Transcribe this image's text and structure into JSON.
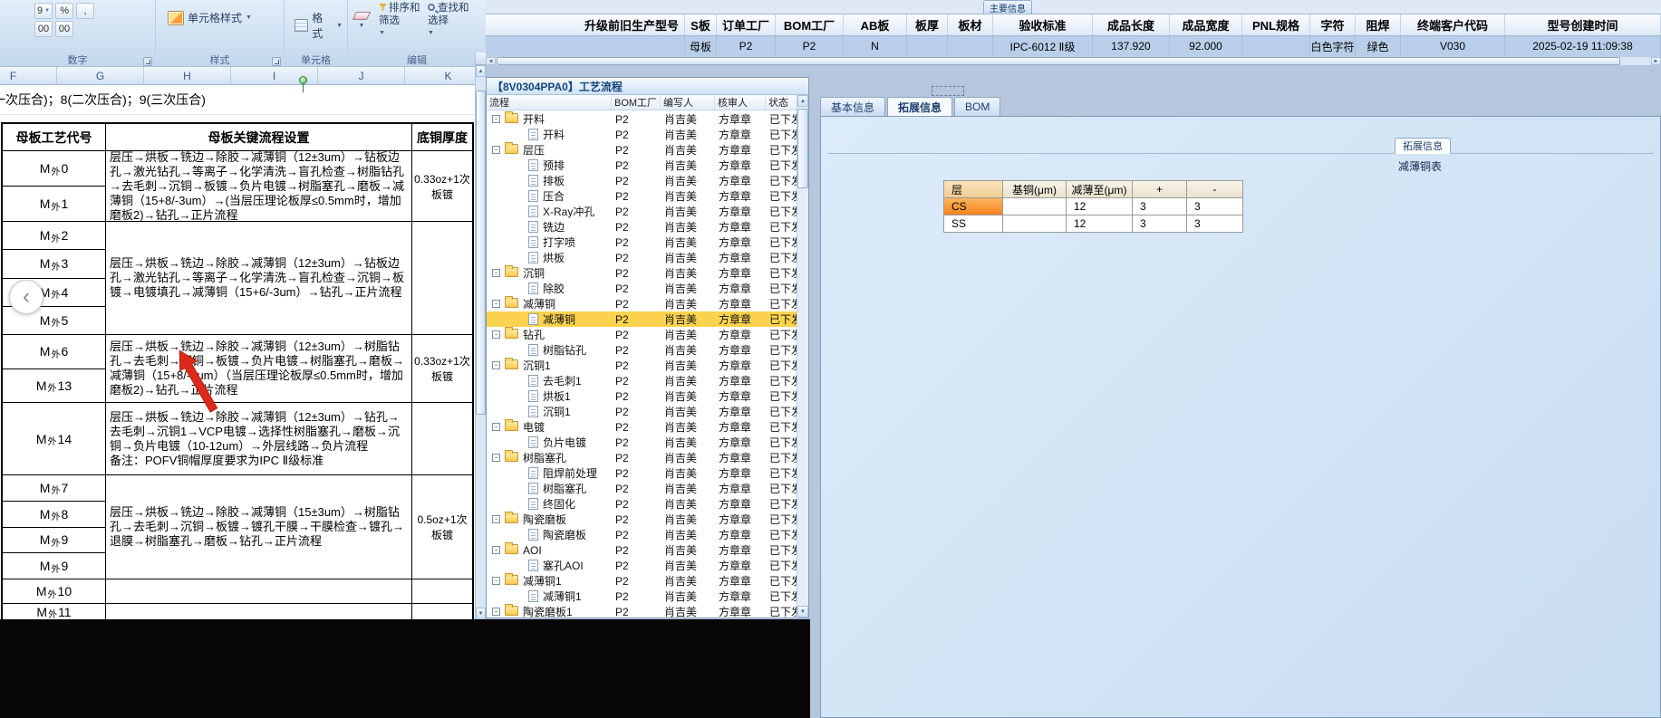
{
  "icons": {
    "dropdown": "▼",
    "percent": "%",
    "comma": ",",
    "currency": "9",
    "decimal_inc": "00",
    "decimal_dec": "00",
    "scroll_up": "▲",
    "scroll_down": "▼",
    "scroll_left": "◄",
    "scroll_right": "►",
    "collapse": "-",
    "nav_prev": "‹"
  },
  "colors": {
    "selected_row": "#fbd34f",
    "cs_cell": "#f5821e",
    "annotation_arrow": "#dd2a1a"
  },
  "excel": {
    "ribbon": {
      "groups": [
        {
          "label": "数字"
        },
        {
          "label": "样式",
          "button": "单元格样式"
        },
        {
          "label": "单元格",
          "button": "格式"
        },
        {
          "label": "编辑",
          "buttons": [
            "排序和筛选",
            "查找和选择"
          ]
        }
      ]
    },
    "column_headers": [
      "F",
      "G",
      "H",
      "I",
      "J",
      "K"
    ],
    "active_cell_text": "一次压合)；8(二次压合)；9(三次压合)",
    "table": {
      "headers": [
        "母板工艺代号",
        "母板关键流程设置",
        "底铜厚度"
      ],
      "blocks": [
        {
          "codes": [
            "M外0",
            "M外1"
          ],
          "flow": "层压→烘板→铣边→除胶→减薄铜（12±3um）→钻板边孔→激光钻孔→等离子→化学清洗→盲孔检查→树脂钻孔→去毛刺→沉铜→板镀→负片电镀→树脂塞孔→磨板→减薄铜（15+8/-3um）→(当层压理论板厚≤0.5mm时，增加磨板2)→钻孔→正片流程",
          "copper": "0.33oz+1次板镀"
        },
        {
          "codes": [
            "M外2",
            "M外3",
            "M外4",
            "M外5"
          ],
          "flow": "层压→烘板→铣边→除胶→减薄铜（12±3um）→钻板边孔→激光钻孔→等离子→化学清洗→盲孔检查→沉铜→板镀→电镀填孔→减薄铜（15+6/-3um）→钻孔→正片流程",
          "copper": ""
        },
        {
          "codes": [
            "M外6",
            "M外13"
          ],
          "flow": "层压→烘板→铣边→除胶→减薄铜（12±3um）→树脂钻孔→去毛刺→沉铜→板镀→负片电镀→树脂塞孔→磨板→减薄铜（15+8/-3um）（当层压理论板厚≤0.5mm时，增加磨板2)→钻孔→正片流程",
          "copper": "0.33oz+1次板镀"
        },
        {
          "codes": [
            "M外14"
          ],
          "flow": "层压→烘板→铣边→除胶→减薄铜（12±3um）→钻孔→去毛刺→沉铜1→VCP电镀→选择性树脂塞孔→磨板→沉铜→负片电镀（10-12um）→外层线路→负片流程\n备注：POFV铜帽厚度要求为IPC Ⅱ级标准",
          "copper": ""
        },
        {
          "codes": [
            "M外7",
            "M外8",
            "M外9",
            "M外9"
          ],
          "flow": "层压→烘板→铣边→除胶→减薄铜（15±3um）→树脂钻孔→去毛刺→沉铜→板镀→镀孔干膜→干膜检查→镀孔→退膜→树脂塞孔→磨板→钻孔→正片流程",
          "copper": "0.5oz+1次板镀"
        },
        {
          "codes": [
            "M外10"
          ],
          "flow": "",
          "copper": ""
        },
        {
          "codes": [
            "M外11"
          ],
          "flow": "",
          "copper": ""
        }
      ]
    }
  },
  "top_grid": {
    "tab_label": "主要信息",
    "columns": [
      "升级前旧生产型号",
      "S板",
      "订单工厂",
      "BOM工厂",
      "AB板",
      "板厚",
      "板材",
      "验收标准",
      "成品长度",
      "成品宽度",
      "PNL规格",
      "字符",
      "阻焊",
      "终端客户代码",
      "型号创建时间"
    ],
    "row": [
      "",
      "母板",
      "P2",
      "P2",
      "N",
      "",
      "",
      "IPC-6012 Ⅱ级",
      "137.920",
      "92.000",
      "",
      "白色字符",
      "绿色",
      "V030",
      "2025-02-19 11:09:38"
    ]
  },
  "tree": {
    "window_title": "【8V0304PPA0】工艺流程",
    "columns": [
      "流程",
      "BOM工厂",
      "编写人",
      "核审人",
      "状态"
    ],
    "defaults": {
      "factory": "P2",
      "writer": "肖吉美",
      "auditor": "方章章",
      "status": "已下发"
    },
    "nodes": [
      {
        "name": "开料",
        "folder": true
      },
      {
        "name": "开料"
      },
      {
        "name": "层压",
        "folder": true
      },
      {
        "name": "预排"
      },
      {
        "name": "排板"
      },
      {
        "name": "压合"
      },
      {
        "name": "X-Ray冲孔"
      },
      {
        "name": "铣边"
      },
      {
        "name": "打字喷"
      },
      {
        "name": "烘板"
      },
      {
        "name": "沉铜",
        "folder": true
      },
      {
        "name": "除胶"
      },
      {
        "name": "减薄铜",
        "folder": true
      },
      {
        "name": "减薄铜",
        "selected": true
      },
      {
        "name": "钻孔",
        "folder": true
      },
      {
        "name": "树脂钻孔"
      },
      {
        "name": "沉铜1",
        "folder": true
      },
      {
        "name": "去毛刺1"
      },
      {
        "name": "烘板1"
      },
      {
        "name": "沉铜1"
      },
      {
        "name": "电镀",
        "folder": true
      },
      {
        "name": "负片电镀"
      },
      {
        "name": "树脂塞孔",
        "folder": true
      },
      {
        "name": "阻焊前处理"
      },
      {
        "name": "树脂塞孔"
      },
      {
        "name": "终固化"
      },
      {
        "name": "陶瓷磨板",
        "folder": true
      },
      {
        "name": "陶瓷磨板"
      },
      {
        "name": "AOI",
        "folder": true
      },
      {
        "name": "塞孔AOI"
      },
      {
        "name": "减薄铜1",
        "folder": true
      },
      {
        "name": "减薄铜1"
      },
      {
        "name": "陶瓷磨板1",
        "folder": true
      }
    ]
  },
  "right_panel": {
    "tabs": [
      "基本信息",
      "拓展信息",
      "BOM"
    ],
    "active_tab": "拓展信息",
    "groupbox_caption": "拓展信息",
    "table_title": "减薄铜表",
    "table": {
      "headers": [
        "层",
        "基铜(μm)",
        "减薄至(μm)",
        "+",
        "-"
      ],
      "rows": [
        {
          "layer": "CS",
          "base": "",
          "thin_to": "12",
          "plus": "3",
          "minus": "3"
        },
        {
          "layer": "SS",
          "base": "",
          "thin_to": "12",
          "plus": "3",
          "minus": "3"
        }
      ]
    }
  }
}
